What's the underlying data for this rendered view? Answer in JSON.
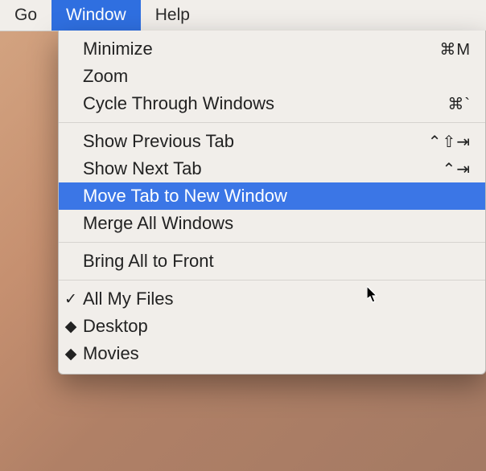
{
  "menubar": {
    "items": [
      {
        "label": "Go",
        "active": false
      },
      {
        "label": "Window",
        "active": true
      },
      {
        "label": "Help",
        "active": false
      }
    ]
  },
  "dropdown": {
    "sections": [
      {
        "items": [
          {
            "label": "Minimize",
            "shortcut": "⌘M",
            "marker": ""
          },
          {
            "label": "Zoom",
            "shortcut": "",
            "marker": ""
          },
          {
            "label": "Cycle Through Windows",
            "shortcut": "⌘`",
            "marker": ""
          }
        ]
      },
      {
        "items": [
          {
            "label": "Show Previous Tab",
            "shortcut": "⌃⇧⇥",
            "marker": ""
          },
          {
            "label": "Show Next Tab",
            "shortcut": "⌃⇥",
            "marker": ""
          },
          {
            "label": "Move Tab to New Window",
            "shortcut": "",
            "marker": "",
            "selected": true
          },
          {
            "label": "Merge All Windows",
            "shortcut": "",
            "marker": ""
          }
        ]
      },
      {
        "items": [
          {
            "label": "Bring All to Front",
            "shortcut": "",
            "marker": ""
          }
        ]
      },
      {
        "items": [
          {
            "label": "All My Files",
            "shortcut": "",
            "marker": "✓"
          },
          {
            "label": "Desktop",
            "shortcut": "",
            "marker": "◆"
          },
          {
            "label": "Movies",
            "shortcut": "",
            "marker": "◆"
          }
        ]
      }
    ]
  }
}
